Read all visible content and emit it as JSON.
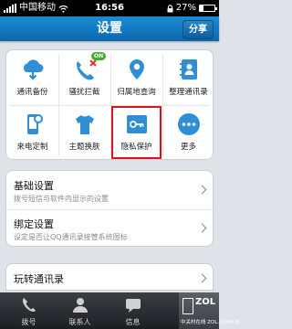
{
  "status_bar": {
    "carrier": "中国移动",
    "time": "16:56",
    "battery_text": "27%",
    "battery_level": 0.27
  },
  "header": {
    "title": "设置",
    "share_label": "分享",
    "accent_color": "#1479c2"
  },
  "grid": {
    "items": [
      {
        "label": "通讯备份",
        "icon": "cloud-sync-icon"
      },
      {
        "label": "骚扰拦截",
        "icon": "phone-block-icon",
        "badge": "ON"
      },
      {
        "label": "归属地查询",
        "icon": "location-pin-icon"
      },
      {
        "label": "整理通讯录",
        "icon": "contacts-book-icon"
      },
      {
        "label": "来电定制",
        "icon": "phone-gear-icon"
      },
      {
        "label": "主题换肤",
        "icon": "tshirt-icon"
      },
      {
        "label": "隐私保护",
        "icon": "key-icon",
        "highlighted": true
      },
      {
        "label": "更多",
        "icon": "more-dots-icon"
      }
    ],
    "highlight_color": "#e0121c"
  },
  "settings": {
    "basic": {
      "title": "基础设置",
      "subtitle": "拨号短信与软件内显示的设置"
    },
    "bind": {
      "title": "绑定设置",
      "subtitle": "设定是否让QQ通讯录接管系统图标"
    },
    "explore": {
      "title": "玩转通讯录"
    }
  },
  "tab_bar": {
    "tabs": [
      {
        "label": "拨号",
        "icon": "phone-icon"
      },
      {
        "label": "联系人",
        "icon": "contacts-icon"
      },
      {
        "label": "信息",
        "icon": "message-icon"
      }
    ],
    "watermark_big": "ZOL",
    "watermark_small": "中关村在线 ZOL.COM.CN"
  }
}
